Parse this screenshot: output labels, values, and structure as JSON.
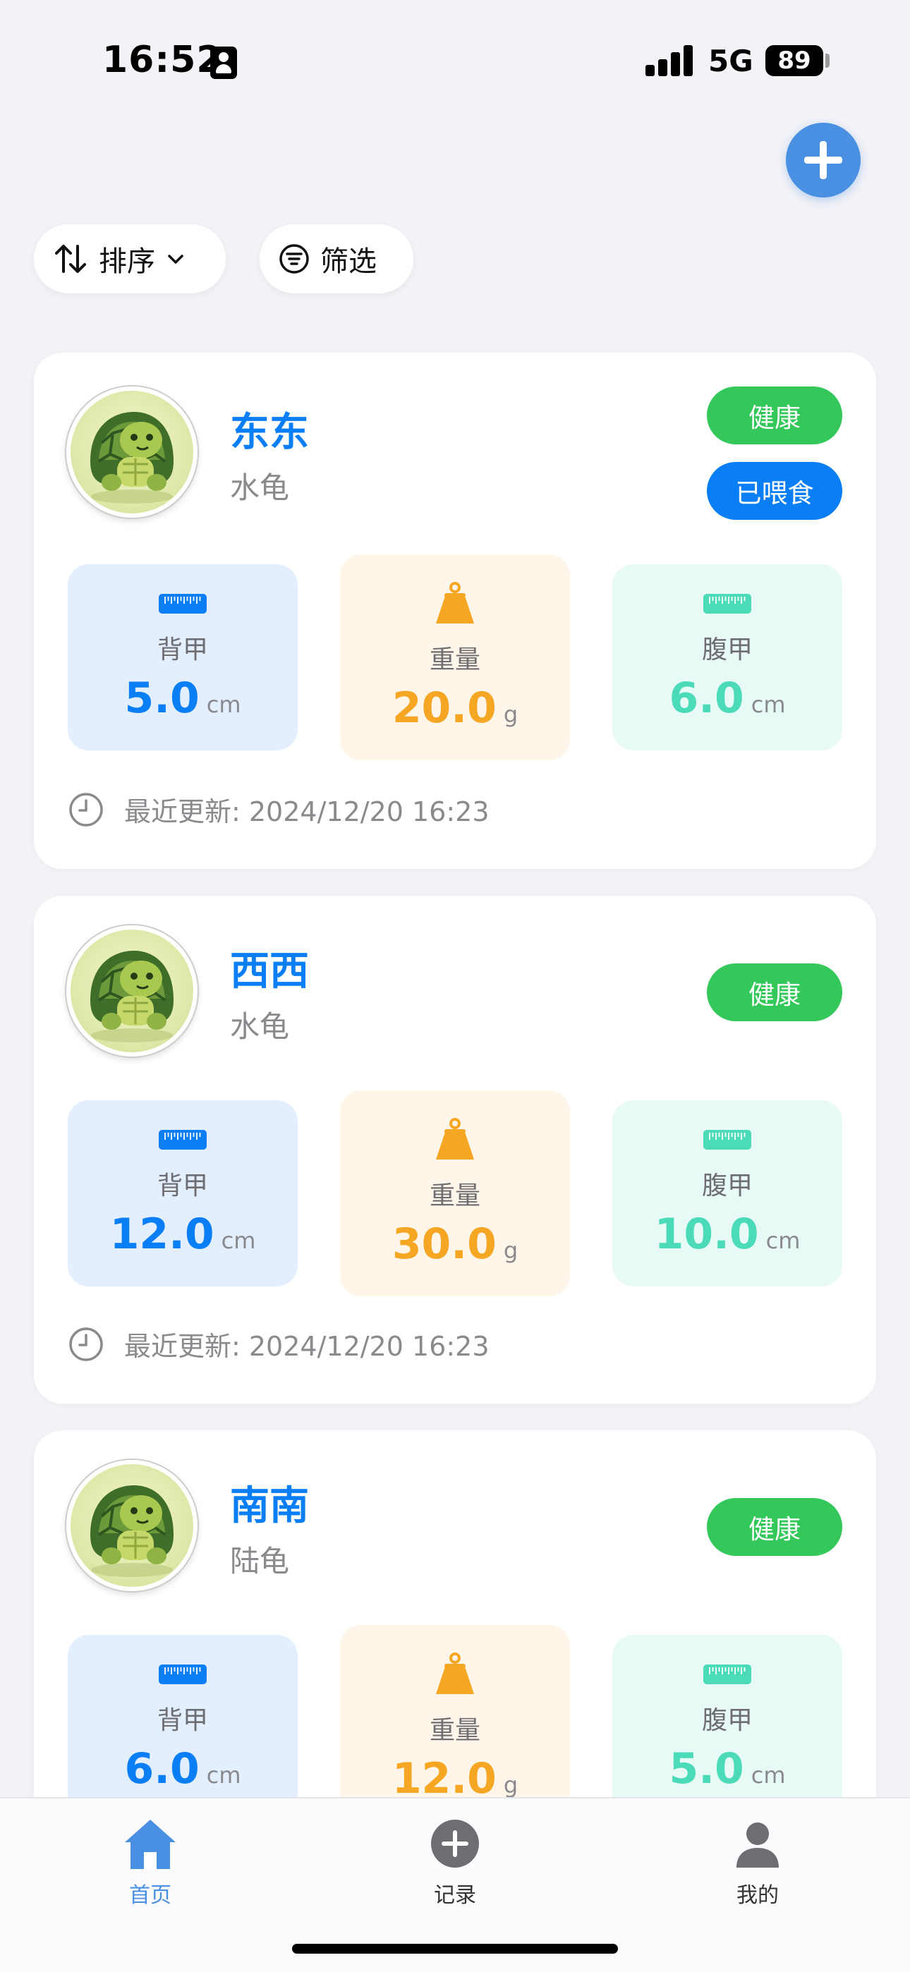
{
  "status_bar": {
    "time": "16:52",
    "network": "5G",
    "battery": "89"
  },
  "toolbar": {
    "add_icon": "plus-icon",
    "sort_label": "排序",
    "filter_label": "筛选"
  },
  "colors": {
    "accent": "#4a90e2",
    "name": "#0a7ff5",
    "health": "#34c759",
    "fed": "#0a7ff5",
    "shell_bg": "#e3efff",
    "weight_bg": "#fff5e8",
    "belly_bg": "#e8faf5",
    "weight_value": "#f5a623",
    "belly_value": "#4cdbb9"
  },
  "stat_labels": {
    "shell": "背甲",
    "weight": "重量",
    "belly": "腹甲"
  },
  "units": {
    "length": "cm",
    "weight": "g"
  },
  "pets": [
    {
      "name": "东东",
      "species": "水龟",
      "badges": [
        "健康",
        "已喂食"
      ],
      "shell": "5.0",
      "weight": "20.0",
      "belly": "6.0",
      "updated": "最近更新: 2024/12/20 16:23"
    },
    {
      "name": "西西",
      "species": "水龟",
      "badges": [
        "健康"
      ],
      "shell": "12.0",
      "weight": "30.0",
      "belly": "10.0",
      "updated": "最近更新: 2024/12/20 16:23"
    },
    {
      "name": "南南",
      "species": "陆龟",
      "badges": [
        "健康"
      ],
      "shell": "6.0",
      "weight": "12.0",
      "belly": "5.0",
      "updated": ""
    }
  ],
  "tabs": [
    {
      "label": "首页",
      "icon": "home-icon",
      "active": true
    },
    {
      "label": "记录",
      "icon": "add-circle-icon",
      "active": false
    },
    {
      "label": "我的",
      "icon": "profile-icon",
      "active": false
    }
  ]
}
